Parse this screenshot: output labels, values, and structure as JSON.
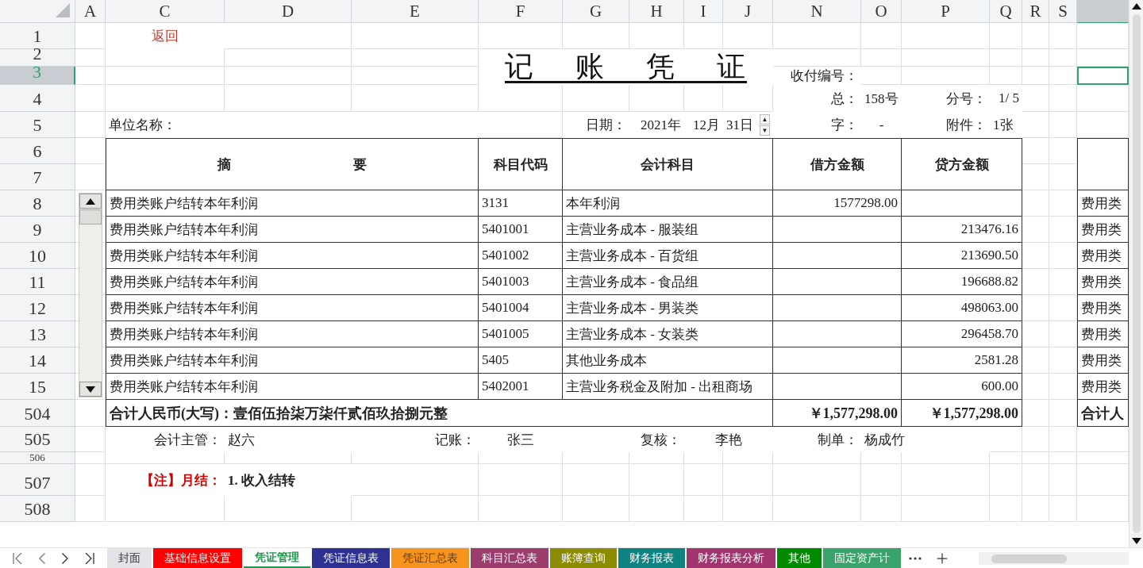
{
  "column_headers": [
    "A",
    "C",
    "D",
    "E",
    "F",
    "G",
    "H",
    "I",
    "J",
    "N",
    "O",
    "P",
    "Q",
    "R",
    "S"
  ],
  "partial_column": {
    "selected": true
  },
  "row_headers": [
    {
      "label": "1",
      "selected": false
    },
    {
      "label": "2",
      "selected": false
    },
    {
      "label": "3",
      "selected": true
    },
    {
      "label": "4",
      "selected": false
    },
    {
      "label": "5",
      "selected": false
    },
    {
      "label": "6",
      "selected": false
    },
    {
      "label": "7",
      "selected": false
    },
    {
      "label": "8",
      "selected": false
    },
    {
      "label": "9",
      "selected": false
    },
    {
      "label": "10",
      "selected": false
    },
    {
      "label": "11",
      "selected": false
    },
    {
      "label": "12",
      "selected": false
    },
    {
      "label": "13",
      "selected": false
    },
    {
      "label": "14",
      "selected": false
    },
    {
      "label": "15",
      "selected": false
    },
    {
      "label": "504",
      "selected": false
    },
    {
      "label": "505",
      "selected": false
    },
    {
      "label": "506",
      "selected": false
    },
    {
      "label": "507",
      "selected": false
    },
    {
      "label": "508",
      "selected": false
    }
  ],
  "back_link": "返回",
  "title": "记 账 凭 证",
  "voucher_no_label": "收付编号：",
  "total_no": {
    "label": "总：",
    "value": "158号"
  },
  "sub_no": {
    "label": "分号：",
    "value": "1/ 5"
  },
  "unit_label": "单位名称：",
  "date": {
    "label": "日期：",
    "year": "2021年",
    "month": "12月",
    "day": "31日",
    "up": "▲",
    "down": "▼"
  },
  "word": {
    "label": "字：",
    "value": "-"
  },
  "attachments": {
    "label": "附件：",
    "value": "1张"
  },
  "table": {
    "columns": [
      "摘 要",
      "科目代码",
      "会计科目",
      "借方金额",
      "贷方金额"
    ],
    "rows": [
      {
        "summary": "费用类账户结转本年利润",
        "code": "3131",
        "account": "本年利润",
        "debit": "1577298.00",
        "credit": ""
      },
      {
        "summary": "费用类账户结转本年利润",
        "code": "5401001",
        "account": "主营业务成本 - 服装组",
        "debit": "",
        "credit": "213476.16"
      },
      {
        "summary": "费用类账户结转本年利润",
        "code": "5401002",
        "account": "主营业务成本 - 百货组",
        "debit": "",
        "credit": "213690.50"
      },
      {
        "summary": "费用类账户结转本年利润",
        "code": "5401003",
        "account": "主营业务成本 - 食品组",
        "debit": "",
        "credit": "196688.82"
      },
      {
        "summary": "费用类账户结转本年利润",
        "code": "5401004",
        "account": "主营业务成本 - 男装类",
        "debit": "",
        "credit": "498063.00"
      },
      {
        "summary": "费用类账户结转本年利润",
        "code": "5401005",
        "account": "主营业务成本 - 女装类",
        "debit": "",
        "credit": "296458.70"
      },
      {
        "summary": "费用类账户结转本年利润",
        "code": "5405",
        "account": "其他业务成本",
        "debit": "",
        "credit": "2581.28"
      },
      {
        "summary": "费用类账户结转本年利润",
        "code": "5402001",
        "account": "主营业务税金及附加 - 出租商场",
        "debit": "",
        "credit": "600.00"
      }
    ],
    "total": {
      "label": "合计人民币(大写)：壹佰伍拾柒万柒仟贰佰玖拾捌元整",
      "debit": "￥1,577,298.00",
      "credit": "￥1,577,298.00"
    }
  },
  "peek": {
    "rows": [
      "费用类",
      "费用类",
      "费用类",
      "费用类",
      "费用类",
      "费用类",
      "费用类",
      "费用类"
    ],
    "total": "合计人"
  },
  "signatures": [
    {
      "label": "会计主管：",
      "value": "赵六"
    },
    {
      "label": "记账：",
      "value": "张三"
    },
    {
      "label": "复核：",
      "value": "李艳"
    },
    {
      "label": "制单：",
      "value": "杨成竹"
    }
  ],
  "note": {
    "label": "【注】月结：",
    "text": "1. 收入结转"
  },
  "tabs": [
    {
      "label": "封面",
      "color": "#e3e4e8",
      "selected": false
    },
    {
      "label": "基础信息设置",
      "color": "#ff0000",
      "selected": false
    },
    {
      "label": "凭证管理",
      "color": "#ffffff",
      "selected": true
    },
    {
      "label": "凭证信息表",
      "color": "#2e3192",
      "selected": false
    },
    {
      "label": "凭证汇总表",
      "color": "#f7941d",
      "selected": false
    },
    {
      "label": "科目汇总表",
      "color": "#9c3d6e",
      "selected": false
    },
    {
      "label": "账簿查询",
      "color": "#8c8c00",
      "selected": false
    },
    {
      "label": "财务报表",
      "color": "#0f8282",
      "selected": false
    },
    {
      "label": "财务报表分析",
      "color": "#a2356f",
      "selected": false
    },
    {
      "label": "其他",
      "color": "#008a00",
      "selected": false
    },
    {
      "label": "固定资产计",
      "color": "#3aa36c",
      "selected": false
    }
  ]
}
